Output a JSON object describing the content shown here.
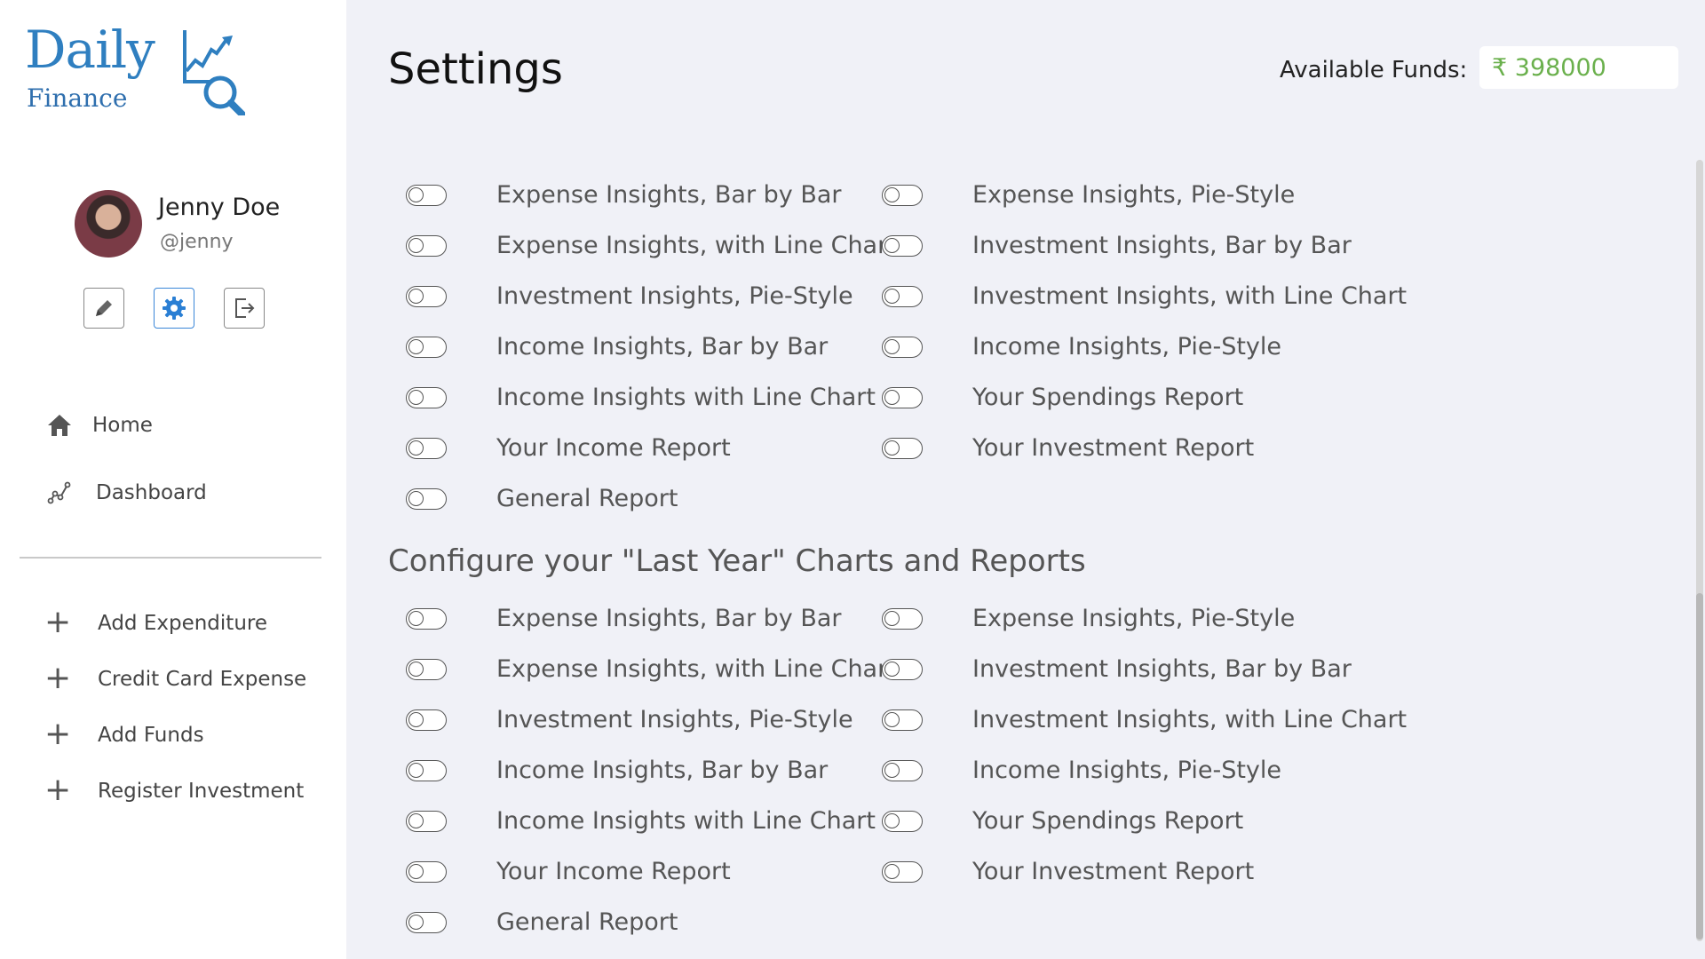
{
  "brand": {
    "name_top": "Daily",
    "name_bottom": "Finance",
    "logo_icon": "chart-magnifier-icon"
  },
  "profile": {
    "name": "Jenny Doe",
    "handle": "@jenny"
  },
  "profile_actions": [
    {
      "icon": "pencil-icon"
    },
    {
      "icon": "gear-icon"
    },
    {
      "icon": "logout-icon"
    }
  ],
  "nav": [
    {
      "label": "Home",
      "icon": "home-icon"
    },
    {
      "label": "Dashboard",
      "icon": "chart-line-icon"
    }
  ],
  "actions": [
    {
      "label": "Add Expenditure"
    },
    {
      "label": "Credit Card Expense"
    },
    {
      "label": "Add Funds"
    },
    {
      "label": "Register Investment"
    }
  ],
  "header": {
    "title": "Settings",
    "funds_label": "Available Funds:",
    "funds_value": "₹ 398000"
  },
  "section_last_year": {
    "heading": "Configure your \"Last Year\" Charts and Reports"
  },
  "toggles_section1": {
    "col1": [
      "Expense Insights, Bar by Bar",
      "Expense Insights, with Line Chart",
      "Investment Insights, Pie-Style",
      "Income Insights, Bar by Bar",
      "Income Insights with Line Chart",
      "Your Income Report",
      "General Report"
    ],
    "col2": [
      "Expense Insights, Pie-Style",
      "Investment Insights, Bar by Bar",
      "Investment Insights, with Line Chart",
      "Income Insights, Pie-Style",
      "Your Spendings Report",
      "Your Investment Report"
    ]
  },
  "toggles_section2": {
    "col1": [
      "Expense Insights, Bar by Bar",
      "Expense Insights, with Line Chart",
      "Investment Insights, Pie-Style",
      "Income Insights, Bar by Bar",
      "Income Insights with Line Chart",
      "Your Income Report",
      "General Report"
    ],
    "col2": [
      "Expense Insights, Pie-Style",
      "Investment Insights, Bar by Bar",
      "Investment Insights, with Line Chart",
      "Income Insights, Pie-Style",
      "Your Spendings Report",
      "Your Investment Report"
    ]
  },
  "colors": {
    "accent": "#2f7fc0",
    "funds": "#6ab04c",
    "background": "#f0f1f7"
  }
}
